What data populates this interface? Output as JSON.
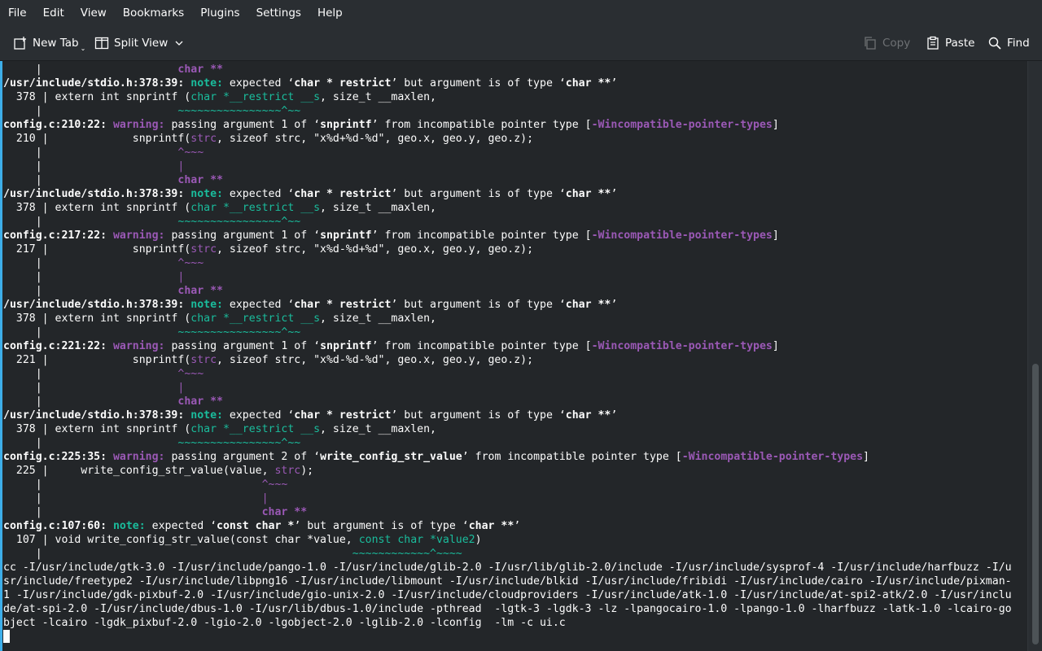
{
  "menubar": {
    "items": [
      "File",
      "Edit",
      "View",
      "Bookmarks",
      "Plugins",
      "Settings",
      "Help"
    ]
  },
  "toolbar": {
    "new_tab": "New Tab",
    "split_view": "Split View",
    "copy": "Copy",
    "paste": "Paste",
    "find": "Find"
  },
  "icons": {
    "new_tab": "new-tab-icon",
    "split_view": "split-view-icon",
    "copy": "copy-icon",
    "paste": "paste-icon",
    "find": "search-icon"
  },
  "colors": {
    "background": "#232629",
    "text": "#fcfcfc",
    "note": "#1abc9c",
    "warning": "#9b59b6",
    "accent": "#3daee9"
  },
  "terminal": {
    "lines": [
      [
        [
          "     |                     ",
          ""
        ],
        [
          "char **",
          "p b"
        ]
      ],
      [
        [
          "/usr/include/stdio.h:378:39: ",
          "b"
        ],
        [
          "note:",
          "g b"
        ],
        [
          " expected ‘",
          ""
        ],
        [
          "char * restrict",
          "b"
        ],
        [
          "’ but argument is of type ‘",
          ""
        ],
        [
          "char **",
          "b"
        ],
        [
          "’",
          ""
        ]
      ],
      [
        [
          "  378 | extern int snprintf (",
          ""
        ],
        [
          "char *__restrict __s",
          "g"
        ],
        [
          ", size_t __maxlen,",
          ""
        ]
      ],
      [
        [
          "     |                     ",
          ""
        ],
        [
          "~~~~~~~~~~~~~~~~^~~",
          "g"
        ]
      ],
      [
        [
          "config.c:210:22: ",
          "b"
        ],
        [
          "warning:",
          "p b"
        ],
        [
          " passing argument 1 of ‘",
          ""
        ],
        [
          "snprintf",
          "b"
        ],
        [
          "’ from incompatible pointer type [",
          ""
        ],
        [
          "-Wincompatible-pointer-types",
          "p b"
        ],
        [
          "]",
          ""
        ]
      ],
      [
        [
          "  210 |             snprintf(",
          ""
        ],
        [
          "strc",
          "p"
        ],
        [
          ", sizeof strc, \"x%d+%d-%d\", geo.x, geo.y, geo.z);",
          ""
        ]
      ],
      [
        [
          "     |                     ",
          ""
        ],
        [
          "^~~~",
          "p"
        ]
      ],
      [
        [
          "     |                     ",
          ""
        ],
        [
          "|",
          "p"
        ]
      ],
      [
        [
          "     |                     ",
          ""
        ],
        [
          "char **",
          "p b"
        ]
      ],
      [
        [
          "/usr/include/stdio.h:378:39: ",
          "b"
        ],
        [
          "note:",
          "g b"
        ],
        [
          " expected ‘",
          ""
        ],
        [
          "char * restrict",
          "b"
        ],
        [
          "’ but argument is of type ‘",
          ""
        ],
        [
          "char **",
          "b"
        ],
        [
          "’",
          ""
        ]
      ],
      [
        [
          "  378 | extern int snprintf (",
          ""
        ],
        [
          "char *__restrict __s",
          "g"
        ],
        [
          ", size_t __maxlen,",
          ""
        ]
      ],
      [
        [
          "     |                     ",
          ""
        ],
        [
          "~~~~~~~~~~~~~~~~^~~",
          "g"
        ]
      ],
      [
        [
          "config.c:217:22: ",
          "b"
        ],
        [
          "warning:",
          "p b"
        ],
        [
          " passing argument 1 of ‘",
          ""
        ],
        [
          "snprintf",
          "b"
        ],
        [
          "’ from incompatible pointer type [",
          ""
        ],
        [
          "-Wincompatible-pointer-types",
          "p b"
        ],
        [
          "]",
          ""
        ]
      ],
      [
        [
          "  217 |             snprintf(",
          ""
        ],
        [
          "strc",
          "p"
        ],
        [
          ", sizeof strc, \"x%d-%d+%d\", geo.x, geo.y, geo.z);",
          ""
        ]
      ],
      [
        [
          "     |                     ",
          ""
        ],
        [
          "^~~~",
          "p"
        ]
      ],
      [
        [
          "     |                     ",
          ""
        ],
        [
          "|",
          "p"
        ]
      ],
      [
        [
          "     |                     ",
          ""
        ],
        [
          "char **",
          "p b"
        ]
      ],
      [
        [
          "/usr/include/stdio.h:378:39: ",
          "b"
        ],
        [
          "note:",
          "g b"
        ],
        [
          " expected ‘",
          ""
        ],
        [
          "char * restrict",
          "b"
        ],
        [
          "’ but argument is of type ‘",
          ""
        ],
        [
          "char **",
          "b"
        ],
        [
          "’",
          ""
        ]
      ],
      [
        [
          "  378 | extern int snprintf (",
          ""
        ],
        [
          "char *__restrict __s",
          "g"
        ],
        [
          ", size_t __maxlen,",
          ""
        ]
      ],
      [
        [
          "     |                     ",
          ""
        ],
        [
          "~~~~~~~~~~~~~~~~^~~",
          "g"
        ]
      ],
      [
        [
          "config.c:221:22: ",
          "b"
        ],
        [
          "warning:",
          "p b"
        ],
        [
          " passing argument 1 of ‘",
          ""
        ],
        [
          "snprintf",
          "b"
        ],
        [
          "’ from incompatible pointer type [",
          ""
        ],
        [
          "-Wincompatible-pointer-types",
          "p b"
        ],
        [
          "]",
          ""
        ]
      ],
      [
        [
          "  221 |             snprintf(",
          ""
        ],
        [
          "strc",
          "p"
        ],
        [
          ", sizeof strc, \"x%d-%d-%d\", geo.x, geo.y, geo.z);",
          ""
        ]
      ],
      [
        [
          "     |                     ",
          ""
        ],
        [
          "^~~~",
          "p"
        ]
      ],
      [
        [
          "     |                     ",
          ""
        ],
        [
          "|",
          "p"
        ]
      ],
      [
        [
          "     |                     ",
          ""
        ],
        [
          "char **",
          "p b"
        ]
      ],
      [
        [
          "/usr/include/stdio.h:378:39: ",
          "b"
        ],
        [
          "note:",
          "g b"
        ],
        [
          " expected ‘",
          ""
        ],
        [
          "char * restrict",
          "b"
        ],
        [
          "’ but argument is of type ‘",
          ""
        ],
        [
          "char **",
          "b"
        ],
        [
          "’",
          ""
        ]
      ],
      [
        [
          "  378 | extern int snprintf (",
          ""
        ],
        [
          "char *__restrict __s",
          "g"
        ],
        [
          ", size_t __maxlen,",
          ""
        ]
      ],
      [
        [
          "     |                     ",
          ""
        ],
        [
          "~~~~~~~~~~~~~~~~^~~",
          "g"
        ]
      ],
      [
        [
          "config.c:225:35: ",
          "b"
        ],
        [
          "warning:",
          "p b"
        ],
        [
          " passing argument 2 of ‘",
          ""
        ],
        [
          "write_config_str_value",
          "b"
        ],
        [
          "’ from incompatible pointer type [",
          ""
        ],
        [
          "-Wincompatible-pointer-types",
          "p b"
        ],
        [
          "]",
          ""
        ]
      ],
      [
        [
          "  225 |     write_config_str_value(value, ",
          ""
        ],
        [
          "strc",
          "p"
        ],
        [
          ");",
          ""
        ]
      ],
      [
        [
          "     |                                  ",
          ""
        ],
        [
          "^~~~",
          "p"
        ]
      ],
      [
        [
          "     |                                  ",
          ""
        ],
        [
          "|",
          "p"
        ]
      ],
      [
        [
          "     |                                  ",
          ""
        ],
        [
          "char **",
          "p b"
        ]
      ],
      [
        [
          "config.c:107:60: ",
          "b"
        ],
        [
          "note:",
          "g b"
        ],
        [
          " expected ‘",
          ""
        ],
        [
          "const char *",
          "b"
        ],
        [
          "’ but argument is of type ‘",
          ""
        ],
        [
          "char **",
          "b"
        ],
        [
          "’",
          ""
        ]
      ],
      [
        [
          "  107 | void write_config_str_value(const char *value, ",
          ""
        ],
        [
          "const char *value2",
          "g"
        ],
        [
          ")",
          ""
        ]
      ],
      [
        [
          "     |                                                ",
          ""
        ],
        [
          "~~~~~~~~~~~~^~~~~",
          "g"
        ]
      ],
      [
        [
          "cc -I/usr/include/gtk-3.0 -I/usr/include/pango-1.0 -I/usr/include/glib-2.0 -I/usr/lib/glib-2.0/include -I/usr/include/sysprof-4 -I/usr/include/harfbuzz -I/u",
          ""
        ]
      ],
      [
        [
          "sr/include/freetype2 -I/usr/include/libpng16 -I/usr/include/libmount -I/usr/include/blkid -I/usr/include/fribidi -I/usr/include/cairo -I/usr/include/pixman-",
          ""
        ]
      ],
      [
        [
          "1 -I/usr/include/gdk-pixbuf-2.0 -I/usr/include/gio-unix-2.0 -I/usr/include/cloudproviders -I/usr/include/atk-1.0 -I/usr/include/at-spi2-atk/2.0 -I/usr/inclu",
          ""
        ]
      ],
      [
        [
          "de/at-spi-2.0 -I/usr/include/dbus-1.0 -I/usr/lib/dbus-1.0/include -pthread  -lgtk-3 -lgdk-3 -lz -lpangocairo-1.0 -lpango-1.0 -lharfbuzz -latk-1.0 -lcairo-go",
          ""
        ]
      ],
      [
        [
          "bject -lcairo -lgdk_pixbuf-2.0 -lgio-2.0 -lgobject-2.0 -lglib-2.0 -lconfig  -lm -c ui.c",
          ""
        ]
      ]
    ]
  }
}
